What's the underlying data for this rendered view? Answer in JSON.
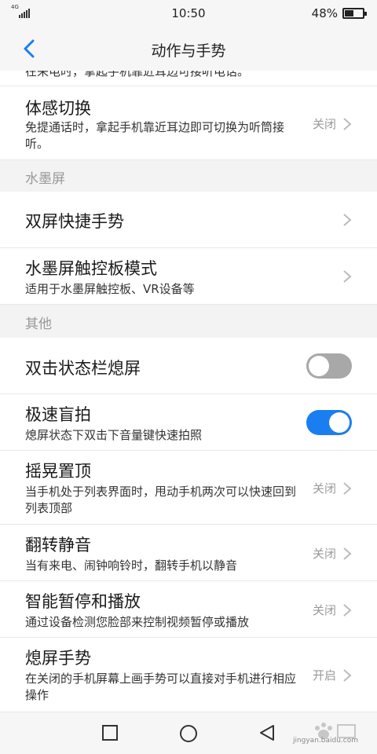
{
  "status_bar": {
    "network": "4G",
    "time": "10:50",
    "battery_text": "48%",
    "battery_level": 0.48
  },
  "header": {
    "title": "动作与手势"
  },
  "rows": {
    "partial_top": {
      "sub": "在来电时，拿起手机靠近耳边可接听电话。"
    },
    "motion_switch": {
      "title": "体感切换",
      "sub": "免提通话时，拿起手机靠近耳边即可切换为听筒接听。",
      "value": "关闭"
    },
    "dual_screen": {
      "title": "双屏快捷手势"
    },
    "ink_touchpad": {
      "title": "水墨屏触控板模式",
      "sub": "适用于水墨屏触控板、VR设备等"
    },
    "double_tap_status": {
      "title": "双击状态栏熄屏",
      "toggle": false
    },
    "quick_shot": {
      "title": "极速盲拍",
      "sub": "熄屏状态下双击下音量键快速拍照",
      "toggle": true
    },
    "shake_top": {
      "title": "摇晃置顶",
      "sub": "当手机处于列表界面时，甩动手机两次可以快速回到列表顶部",
      "value": "关闭"
    },
    "flip_mute": {
      "title": "翻转静音",
      "sub": "当有来电、闹钟响铃时，翻转手机以静音",
      "value": "关闭"
    },
    "smart_pause": {
      "title": "智能暂停和播放",
      "sub": "通过设备检测您脸部来控制视频暂停或播放",
      "value": "关闭"
    },
    "off_screen_gesture": {
      "title": "熄屏手势",
      "sub": "在关闭的手机屏幕上画手势可以直接对手机进行相应操作",
      "value": "开启"
    }
  },
  "sections": {
    "ink": "水墨屏",
    "other": "其他"
  },
  "watermark": {
    "text": "jingyan.baidu.com"
  },
  "colors": {
    "accent": "#1a7ef0",
    "toggle_off": "#a8a8a8",
    "section_bg": "#f3f3f3"
  }
}
